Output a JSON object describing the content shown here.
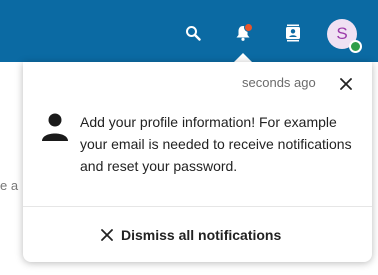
{
  "header": {
    "icons": [
      "search-icon",
      "notifications-bell-icon",
      "contacts-icon"
    ],
    "avatar_initial": "S",
    "brand_color": "#0b6aa3",
    "notification_dot_color": "#e9552b",
    "status_color": "#2f9e49"
  },
  "background": {
    "partial_text": "e a"
  },
  "notifications": {
    "items": [
      {
        "time": "seconds ago",
        "message": "Add your profile information! For example your email is needed to receive notifications and reset your password."
      }
    ],
    "dismiss_all_label": "Dismiss all notifications"
  }
}
